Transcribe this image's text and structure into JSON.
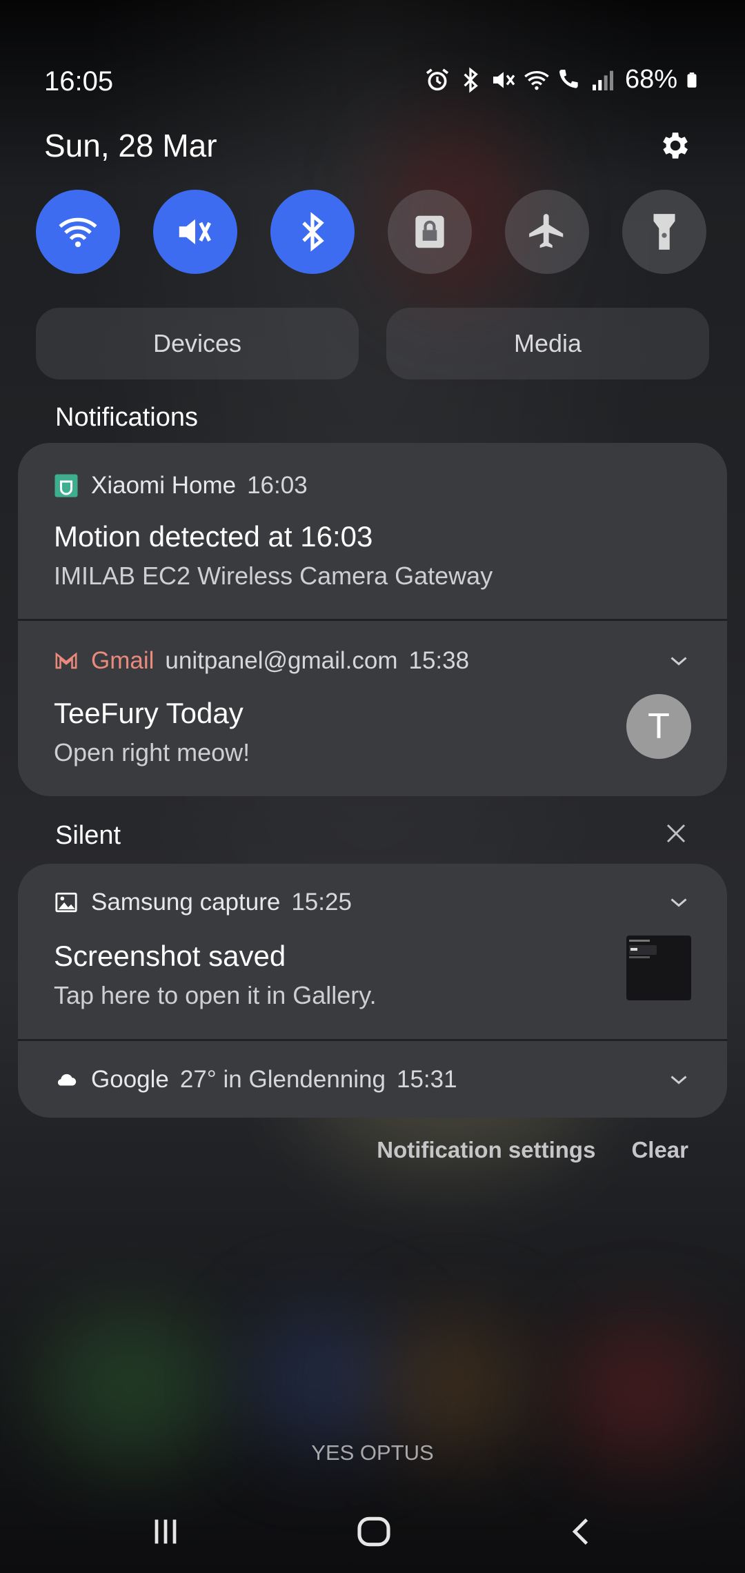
{
  "status_bar": {
    "time": "16:05",
    "battery_percent": "68%",
    "icons": [
      "alarm-icon",
      "bluetooth-icon",
      "mute-icon",
      "wifi-icon",
      "wifi-call-icon",
      "signal-icon",
      "battery-icon"
    ]
  },
  "header": {
    "date": "Sun, 28 Mar"
  },
  "quick_toggles": [
    {
      "name": "wifi",
      "on": true
    },
    {
      "name": "sound-muted",
      "on": true
    },
    {
      "name": "bluetooth",
      "on": true
    },
    {
      "name": "screen-lock",
      "on": false
    },
    {
      "name": "airplane-mode",
      "on": false
    },
    {
      "name": "flashlight",
      "on": false
    }
  ],
  "panels": {
    "devices_label": "Devices",
    "media_label": "Media"
  },
  "sections": {
    "notifications": "Notifications",
    "silent": "Silent"
  },
  "notifications": [
    {
      "app": "Xiaomi Home",
      "time": "16:03",
      "title": "Motion detected at 16:03",
      "text": "IMILAB EC2 Wireless Camera Gateway"
    },
    {
      "app": "Gmail",
      "account": "unitpanel@gmail.com",
      "time": "15:38",
      "title": "TeeFury Today",
      "text": "Open right meow!",
      "avatar_letter": "T"
    }
  ],
  "silent_notifications": [
    {
      "app": "Samsung capture",
      "time": "15:25",
      "title": "Screenshot saved",
      "text": "Tap here to open it in Gallery."
    },
    {
      "app": "Google",
      "weather": "27° in Glendenning",
      "time": "15:31"
    }
  ],
  "footer": {
    "settings_label": "Notification settings",
    "clear_label": "Clear"
  },
  "carrier": "YES OPTUS",
  "colors": {
    "accent": "#3d6cf0",
    "gmail": "#ea8a7c",
    "xiaomi": "#3fae8f"
  }
}
